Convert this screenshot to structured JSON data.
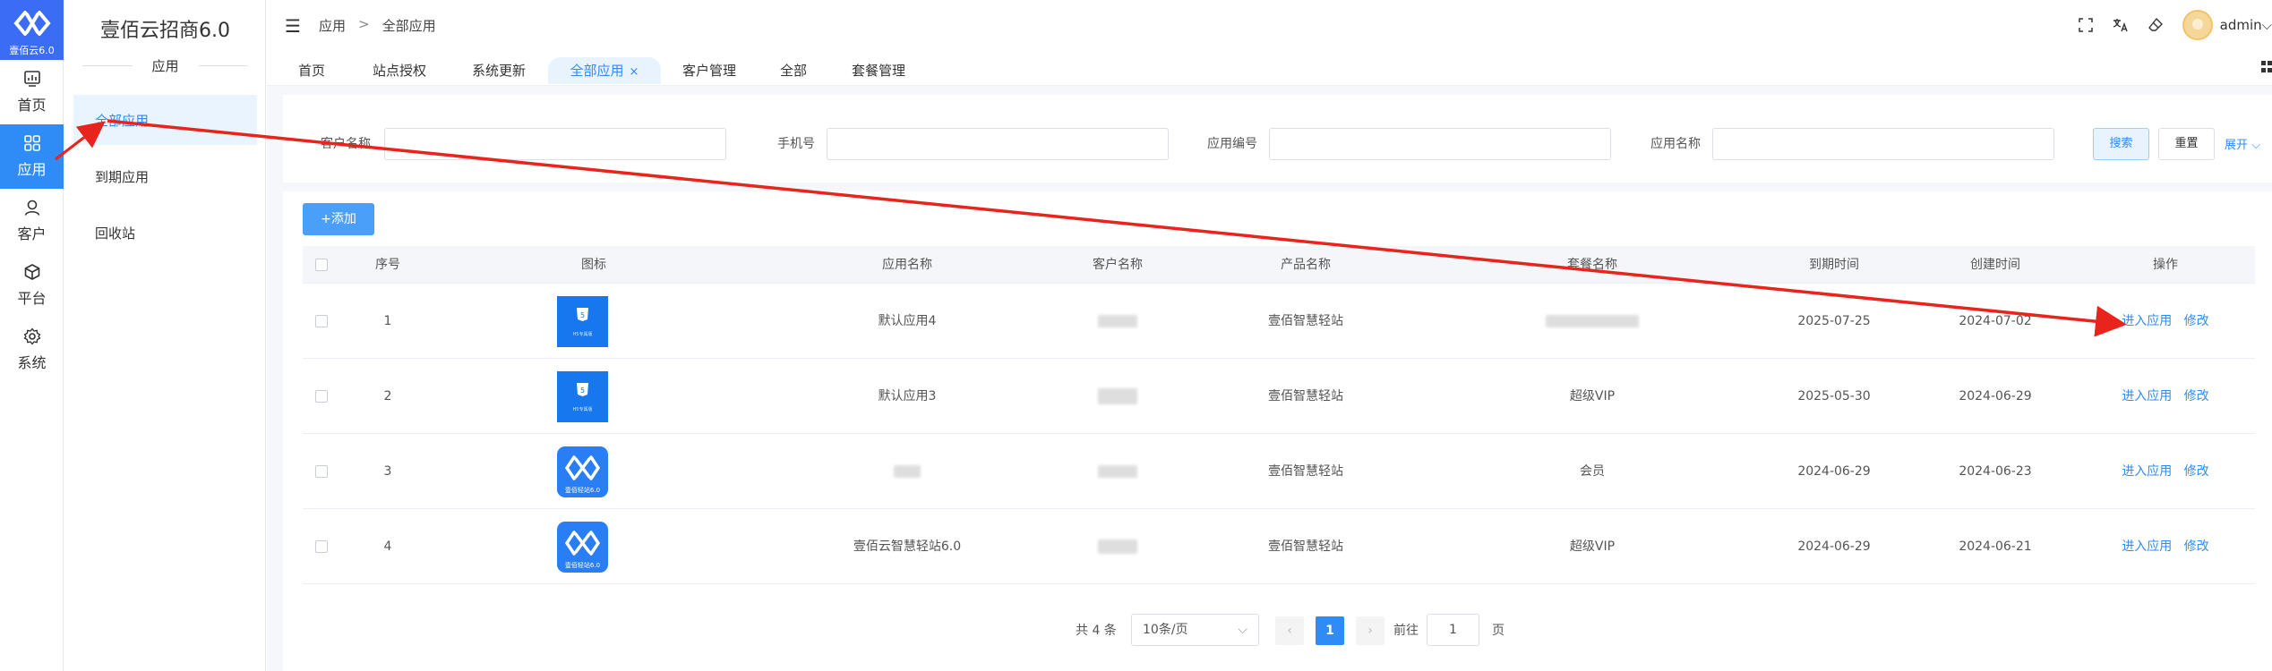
{
  "rail": {
    "logo_text": "壹佰云6.0",
    "items": [
      {
        "label": "首页",
        "icon": "dashboard-icon"
      },
      {
        "label": "应用",
        "icon": "apps-grid-icon",
        "active": true
      },
      {
        "label": "客户",
        "icon": "user-icon"
      },
      {
        "label": "平台",
        "icon": "cube-icon"
      },
      {
        "label": "系统",
        "icon": "gear-icon"
      }
    ]
  },
  "sidebar": {
    "title": "壹佰云招商6.0",
    "group": "应用",
    "items": [
      {
        "label": "全部应用",
        "active": true
      },
      {
        "label": "到期应用"
      },
      {
        "label": "回收站"
      }
    ]
  },
  "header": {
    "breadcrumb": [
      "应用",
      "全部应用"
    ],
    "breadcrumb_sep": ">",
    "user": "admin"
  },
  "tabs": [
    {
      "label": "首页"
    },
    {
      "label": "站点授权"
    },
    {
      "label": "系统更新"
    },
    {
      "label": "全部应用",
      "active": true,
      "close": "×"
    },
    {
      "label": "客户管理"
    },
    {
      "label": "全部"
    },
    {
      "label": "套餐管理"
    }
  ],
  "filter": {
    "fields": [
      "客户名称",
      "手机号",
      "应用编号",
      "应用名称"
    ],
    "search": "搜索",
    "reset": "重置",
    "expand": "展开"
  },
  "toolbar": {
    "add": "+添加"
  },
  "table": {
    "headers": [
      "序号",
      "图标",
      "应用名称",
      "客户名称",
      "产品名称",
      "套餐名称",
      "到期时间",
      "创建时间",
      "操作"
    ],
    "actions": {
      "enter": "进入应用",
      "edit": "修改"
    },
    "rows": [
      {
        "no": "1",
        "icon": "h5",
        "app_name": "默认应用4",
        "product": "壹佰智慧轻站",
        "package": "",
        "package_blurred": true,
        "expire": "2025-07-25",
        "created": "2024-07-02"
      },
      {
        "no": "2",
        "icon": "h5",
        "app_name": "默认应用3",
        "product": "壹佰智慧轻站",
        "package": "超级VIP",
        "expire": "2025-05-30",
        "created": "2024-06-29"
      },
      {
        "no": "3",
        "icon": "logo",
        "app_name": "",
        "app_blurred": true,
        "product": "壹佰智慧轻站",
        "package": "会员",
        "expire": "2024-06-29",
        "created": "2024-06-23"
      },
      {
        "no": "4",
        "icon": "logo",
        "app_name": "壹佰云智慧轻站6.0",
        "product": "壹佰智慧轻站",
        "package": "超级VIP",
        "expire": "2024-06-29",
        "created": "2024-06-21"
      }
    ]
  },
  "icons": {
    "h5_caption": "H5专属版",
    "logo_caption": "壹佰轻站6.0"
  },
  "pagination": {
    "total": "共 4 条",
    "page_size": "10条/页",
    "prev": "‹",
    "current": "1",
    "next": "›",
    "goto": "前往",
    "goto_value": "1",
    "page_unit": "页"
  },
  "colors": {
    "primary": "#2f8cf7",
    "rail_active": "#2f8cf7",
    "logo_bg": "#3b6cf5",
    "annotation_arrow": "#e8241c"
  }
}
